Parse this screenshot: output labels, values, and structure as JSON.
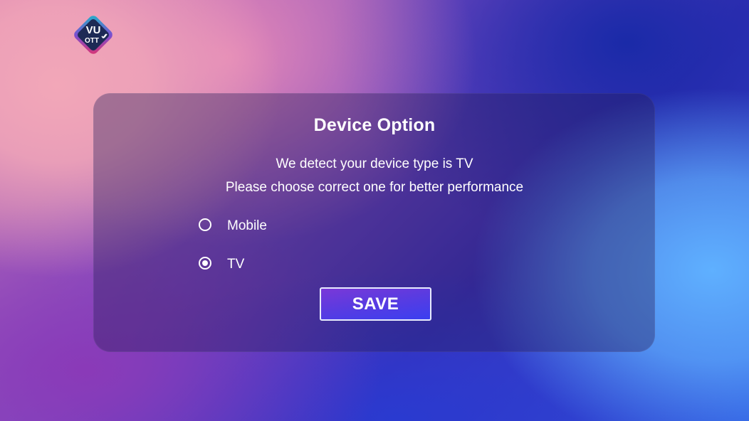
{
  "app": {
    "logo_text_top": "VU",
    "logo_text_bottom": "OTT"
  },
  "dialog": {
    "title": "Device Option",
    "message_line1": "We detect your device type is TV",
    "message_line2": "Please choose correct one for better performance",
    "options": [
      {
        "label": "Mobile",
        "selected": false
      },
      {
        "label": "TV",
        "selected": true
      }
    ],
    "save_label": "SAVE"
  },
  "colors": {
    "accent_button_start": "#7a38d8",
    "accent_button_end": "#3b3ff0",
    "logo_teal": "#1fb6c9",
    "logo_pink": "#e0336e",
    "logo_navy": "#1d2a55"
  },
  "icons": {
    "logo": "vu-ott-logo-icon",
    "radio_unchecked": "radio-unchecked-icon",
    "radio_checked": "radio-checked-icon"
  }
}
